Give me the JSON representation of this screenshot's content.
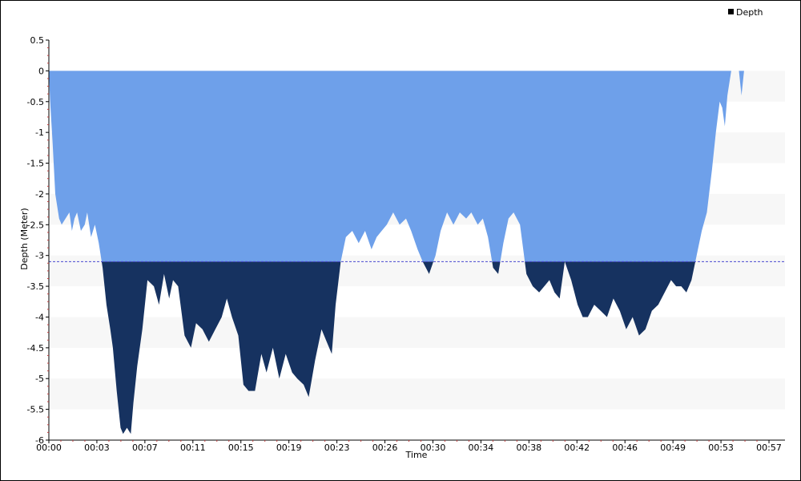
{
  "chart_data": {
    "type": "area",
    "xlabel": "Time",
    "ylabel": "Depth (Meter)",
    "ylim": [
      -6,
      0.5
    ],
    "yticks": [
      0.5,
      0,
      -0.5,
      -1,
      -1.5,
      -2,
      -2.5,
      -3,
      -3.5,
      -4,
      -4.5,
      -5,
      -5.5,
      -6
    ],
    "ytick_labels": [
      "0.5",
      "0",
      "-0.5",
      "-1",
      "-1.5",
      "-2",
      "-2.5",
      "-3",
      "-3.5",
      "-4",
      "-4.5",
      "-5",
      "-5.5",
      "-6"
    ],
    "xlim": [
      0,
      57.5
    ],
    "xticks": [
      0,
      3.75,
      7.5,
      11.25,
      15,
      18.75,
      22.5,
      26.25,
      30,
      33.75,
      37.5,
      41.25,
      45,
      48.75,
      52.5,
      56.25
    ],
    "xtick_labels": [
      "00:00",
      "00:03",
      "00:07",
      "00:11",
      "00:15",
      "00:19",
      "00:23",
      "00:26",
      "00:30",
      "00:34",
      "00:38",
      "00:42",
      "00:46",
      "00:49",
      "00:53",
      "00:57"
    ],
    "threshold": -3.1,
    "grid": "alternating horizontal bands",
    "legend_position": "top-right",
    "series": [
      {
        "name": "Depth",
        "color": "#6ea0ea",
        "below_threshold_color": "#163260",
        "x": [
          0,
          0.1,
          0.3,
          0.5,
          0.8,
          1.0,
          1.3,
          1.6,
          1.8,
          2.0,
          2.2,
          2.5,
          2.8,
          3.0,
          3.3,
          3.6,
          3.9,
          4.2,
          4.5,
          4.8,
          5.0,
          5.3,
          5.6,
          5.8,
          6.1,
          6.4,
          6.6,
          6.9,
          7.3,
          7.7,
          8.2,
          8.6,
          9.0,
          9.4,
          9.7,
          10.1,
          10.6,
          11.1,
          11.5,
          12.0,
          12.5,
          13.0,
          13.5,
          13.9,
          14.3,
          14.8,
          15.2,
          15.6,
          16.1,
          16.6,
          17.0,
          17.5,
          18.0,
          18.5,
          19.0,
          19.4,
          19.9,
          20.3,
          20.8,
          21.3,
          21.7,
          22.1,
          22.4,
          22.8,
          23.2,
          23.7,
          24.2,
          24.7,
          25.2,
          25.6,
          26.0,
          26.4,
          26.9,
          27.4,
          27.9,
          28.3,
          28.8,
          29.2,
          29.7,
          30.2,
          30.6,
          31.1,
          31.6,
          32.1,
          32.6,
          33.0,
          33.5,
          33.9,
          34.3,
          34.7,
          35.1,
          35.5,
          35.9,
          36.3,
          36.8,
          37.3,
          37.8,
          38.3,
          38.7,
          39.1,
          39.5,
          39.9,
          40.3,
          40.8,
          41.3,
          41.7,
          42.1,
          42.6,
          43.1,
          43.6,
          44.1,
          44.6,
          45.1,
          45.6,
          46.1,
          46.6,
          47.1,
          47.6,
          48.1,
          48.6,
          49.0,
          49.4,
          49.8,
          50.2,
          50.6,
          51.0,
          51.4,
          51.8,
          52.1,
          52.4,
          52.6,
          52.8,
          53.0,
          53.3,
          53.6,
          53.9,
          54.1,
          54.2,
          54.3
        ],
        "y": [
          0,
          -0.5,
          -1.2,
          -2.0,
          -2.4,
          -2.5,
          -2.4,
          -2.3,
          -2.6,
          -2.4,
          -2.3,
          -2.6,
          -2.5,
          -2.3,
          -2.7,
          -2.5,
          -2.8,
          -3.2,
          -3.8,
          -4.2,
          -4.5,
          -5.2,
          -5.8,
          -5.9,
          -5.8,
          -5.9,
          -5.4,
          -4.8,
          -4.2,
          -3.4,
          -3.5,
          -3.8,
          -3.3,
          -3.7,
          -3.4,
          -3.5,
          -4.3,
          -4.5,
          -4.1,
          -4.2,
          -4.4,
          -4.2,
          -4.0,
          -3.7,
          -4.0,
          -4.3,
          -5.1,
          -5.2,
          -5.2,
          -4.6,
          -4.9,
          -4.5,
          -5.0,
          -4.6,
          -4.9,
          -5.0,
          -5.1,
          -5.3,
          -4.7,
          -4.2,
          -4.4,
          -4.6,
          -3.8,
          -3.1,
          -2.7,
          -2.6,
          -2.8,
          -2.6,
          -2.9,
          -2.7,
          -2.6,
          -2.5,
          -2.3,
          -2.5,
          -2.4,
          -2.6,
          -2.9,
          -3.1,
          -3.3,
          -3.0,
          -2.6,
          -2.3,
          -2.5,
          -2.3,
          -2.4,
          -2.3,
          -2.5,
          -2.4,
          -2.7,
          -3.2,
          -3.3,
          -2.8,
          -2.4,
          -2.3,
          -2.5,
          -3.3,
          -3.5,
          -3.6,
          -3.5,
          -3.4,
          -3.6,
          -3.7,
          -3.1,
          -3.4,
          -3.8,
          -4.0,
          -4.0,
          -3.8,
          -3.9,
          -4.0,
          -3.7,
          -3.9,
          -4.2,
          -4.0,
          -4.3,
          -4.2,
          -3.9,
          -3.8,
          -3.6,
          -3.4,
          -3.5,
          -3.5,
          -3.6,
          -3.4,
          -3.0,
          -2.6,
          -2.3,
          -1.6,
          -1.0,
          -0.5,
          -0.6,
          -0.9,
          -0.4,
          0,
          0,
          0,
          -0.4,
          -0.2,
          0
        ]
      }
    ]
  }
}
